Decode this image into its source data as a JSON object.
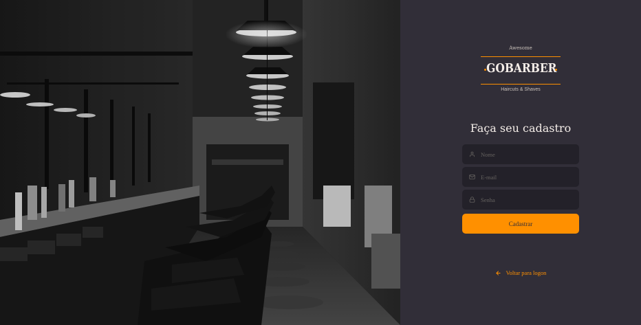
{
  "logo": {
    "top_text": "Awesome",
    "brand": "GOBARBER",
    "bottom_text": "Haircuts & Shaves",
    "accent_color": "#ff9000"
  },
  "form": {
    "title": "Faça seu cadastro",
    "fields": [
      {
        "placeholder": "Nome",
        "icon": "user-icon",
        "type": "text"
      },
      {
        "placeholder": "E-mail",
        "icon": "mail-icon",
        "type": "email"
      },
      {
        "placeholder": "Senha",
        "icon": "lock-icon",
        "type": "password"
      }
    ],
    "submit_label": "Cadastrar"
  },
  "back_link": {
    "label": "Voltar para logon",
    "icon": "arrow-left-icon"
  },
  "colors": {
    "background": "#312e38",
    "input_background": "#232129",
    "accent": "#ff9000",
    "text": "#f4ede8",
    "placeholder": "#666360"
  }
}
